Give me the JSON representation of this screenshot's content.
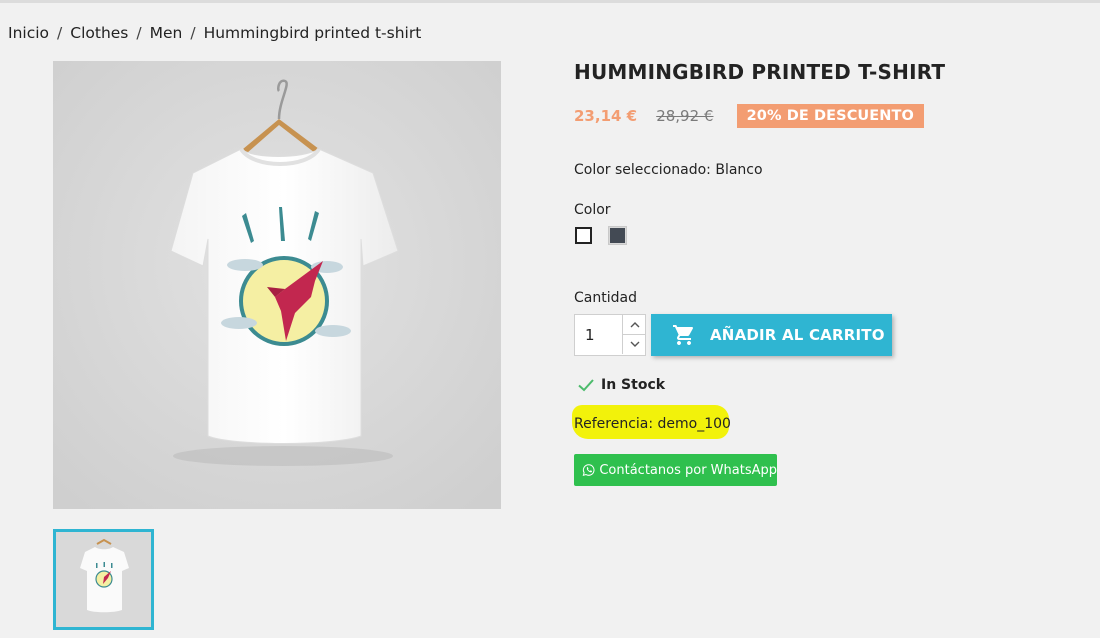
{
  "breadcrumb": {
    "items": [
      "Inicio",
      "Clothes",
      "Men",
      "Hummingbird printed t-shirt"
    ],
    "separator": "/"
  },
  "product": {
    "title": "HUMMINGBIRD PRINTED T-SHIRT",
    "price": "23,14 €",
    "old_price": "28,92 €",
    "discount": "20% DE DESCUENTO",
    "selected_color": "Color seleccionado: Blanco",
    "color_label": "Color",
    "colors": [
      {
        "name": "Blanco",
        "hex": "#ffffff",
        "selected": true
      },
      {
        "name": "Negro",
        "hex": "#434a54",
        "selected": false
      }
    ],
    "quantity_label": "Cantidad",
    "quantity_value": "1",
    "add_to_cart": "AÑADIR AL CARRITO",
    "stock": "In Stock",
    "reference": "Referencia: demo_100",
    "whatsapp": "Contáctanos por WhatsApp"
  },
  "colors": {
    "accent": "#2fb5d2",
    "discount": "#f39d72",
    "whatsapp": "#2fc04e",
    "highlight": "#f2f20b",
    "stock_check": "#4cbb6c"
  },
  "icons": {
    "cart": "shopping-cart-icon",
    "check": "check-icon",
    "whatsapp": "whatsapp-icon",
    "up": "chevron-up-icon",
    "down": "chevron-down-icon"
  }
}
